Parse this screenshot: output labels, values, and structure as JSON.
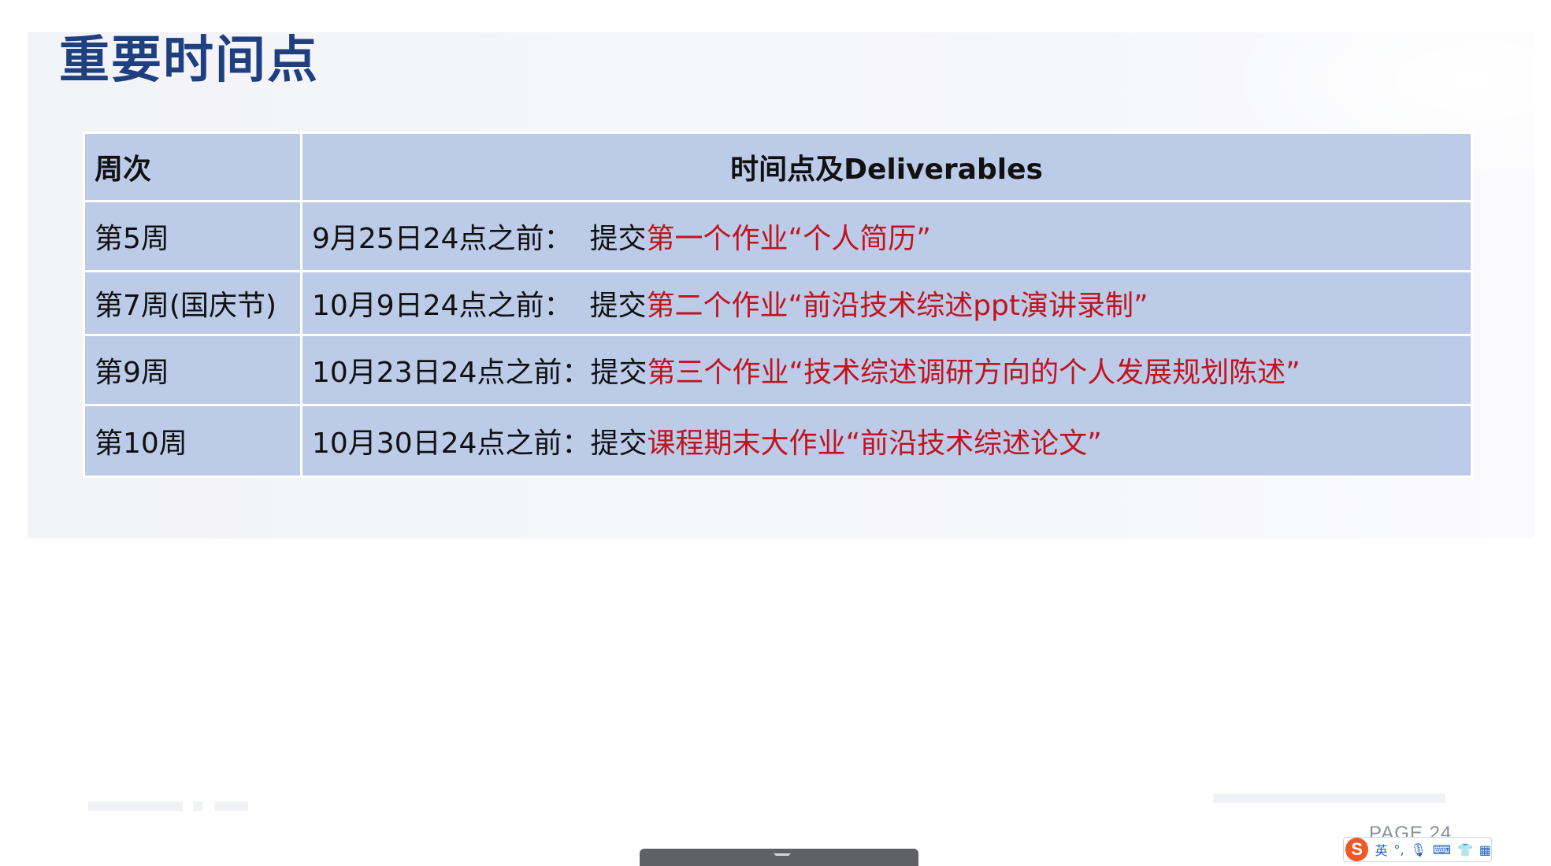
{
  "slide": {
    "title": "重要时间点",
    "page_label": "PAGE 24"
  },
  "table": {
    "headers": [
      "周次",
      "时间点及Deliverables"
    ],
    "rows": [
      {
        "week": "第5周",
        "date": "9月25日24点之前：",
        "action": "提交",
        "deliverable": "第一个作业“个人简历”"
      },
      {
        "week": "第7周(国庆节)",
        "date": "10月9日24点之前：",
        "action": "提交",
        "deliverable": "第二个作业“前沿技术综述ppt演讲录制”"
      },
      {
        "week": "第9周",
        "date": "10月23日24点之前：",
        "action": "提交",
        "deliverable": "第三个作业“技术综述调研方向的个人发展规划陈述”"
      },
      {
        "week": "第10周",
        "date": "10月30日24点之前：",
        "action": "提交",
        "deliverable": "课程期末大作业“前沿技术综述论文”"
      }
    ]
  },
  "ime_toolbar": {
    "logo": "S",
    "mode": "英",
    "icons": [
      "punctuation-icon",
      "microphone-icon",
      "keyboard-icon",
      "skin-icon",
      "grid-icon"
    ]
  },
  "colors": {
    "title": "#1f3f7f",
    "table_bg": "#bccbe8",
    "highlight": "#c0141e"
  }
}
